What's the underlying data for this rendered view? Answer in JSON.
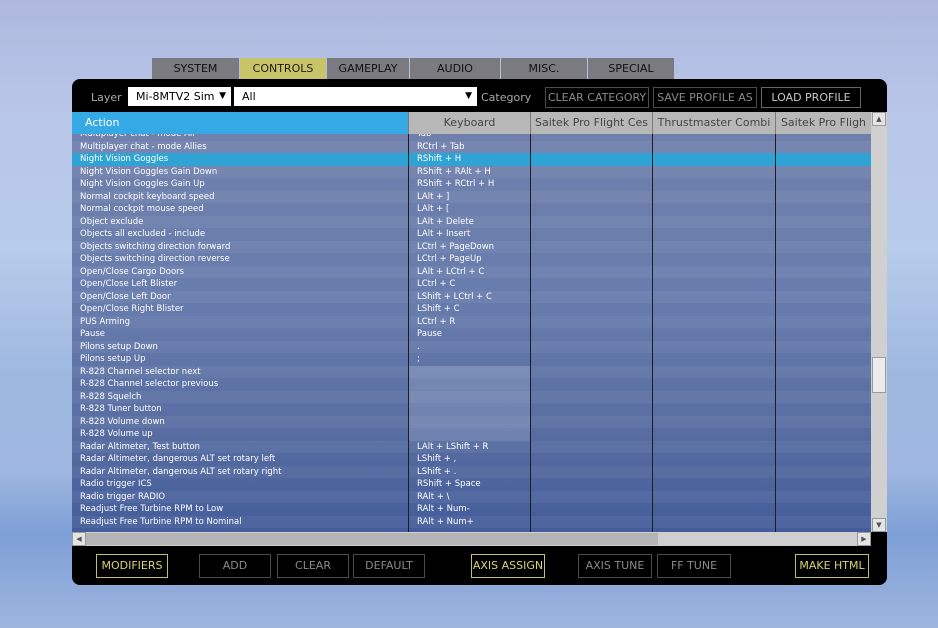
{
  "tabs": [
    {
      "label": "SYSTEM",
      "active": false
    },
    {
      "label": "CONTROLS",
      "active": true
    },
    {
      "label": "GAMEPLAY",
      "active": false
    },
    {
      "label": "AUDIO",
      "active": false
    },
    {
      "label": "MISC.",
      "active": false
    },
    {
      "label": "SPECIAL",
      "active": false
    }
  ],
  "toolbar": {
    "layer_label": "Layer",
    "layer_value": "Mi-8MTV2 Sim",
    "category_value": "All",
    "category_label": "Category",
    "clear_category": "CLEAR CATEGORY",
    "save_profile_as": "SAVE PROFILE AS",
    "load_profile": "LOAD PROFILE"
  },
  "table": {
    "columns": [
      "Action",
      "Keyboard",
      "Saitek Pro Flight Ces",
      "Thrustmaster Combi",
      "Saitek Pro Fligh"
    ],
    "rows": [
      {
        "action": "Multiplayer chat - mode All",
        "keyboard": "Tab"
      },
      {
        "action": "Multiplayer chat - mode Allies",
        "keyboard": "RCtrl + Tab"
      },
      {
        "action": "Night Vision Goggles",
        "keyboard": "RShift + H",
        "selected": true
      },
      {
        "action": "Night Vision Goggles Gain Down",
        "keyboard": "RShift + RAlt + H"
      },
      {
        "action": "Night Vision Goggles Gain Up",
        "keyboard": "RShift + RCtrl + H"
      },
      {
        "action": "Normal cockpit keyboard speed",
        "keyboard": "LAlt + ]"
      },
      {
        "action": "Normal cockpit mouse speed",
        "keyboard": "LAlt + ["
      },
      {
        "action": "Object exclude",
        "keyboard": "LAlt + Delete"
      },
      {
        "action": "Objects all excluded - include",
        "keyboard": "LAlt + Insert"
      },
      {
        "action": "Objects switching direction forward",
        "keyboard": "LCtrl + PageDown"
      },
      {
        "action": "Objects switching direction reverse",
        "keyboard": "LCtrl + PageUp"
      },
      {
        "action": "Open/Close Cargo Doors",
        "keyboard": "LAlt + LCtrl + C"
      },
      {
        "action": "Open/Close Left Blister",
        "keyboard": "LCtrl + C"
      },
      {
        "action": "Open/Close Left Door",
        "keyboard": "LShift + LCtrl + C"
      },
      {
        "action": "Open/Close Right Blister",
        "keyboard": "LShift + C"
      },
      {
        "action": "PUS Arming",
        "keyboard": "LCtrl + R"
      },
      {
        "action": "Pause",
        "keyboard": "Pause"
      },
      {
        "action": "Pilons setup Down",
        "keyboard": "."
      },
      {
        "action": "Pilons setup Up",
        "keyboard": ";"
      },
      {
        "action": "R-828 Channel selector next",
        "keyboard": ""
      },
      {
        "action": "R-828 Channel selector previous",
        "keyboard": ""
      },
      {
        "action": "R-828 Squelch",
        "keyboard": ""
      },
      {
        "action": "R-828 Tuner button",
        "keyboard": ""
      },
      {
        "action": "R-828 Volume down",
        "keyboard": ""
      },
      {
        "action": "R-828 Volume up",
        "keyboard": ""
      },
      {
        "action": "Radar Altimeter, Test button",
        "keyboard": "LAlt + LShift + R"
      },
      {
        "action": "Radar Altimeter, dangerous ALT set rotary left",
        "keyboard": "LShift + ,"
      },
      {
        "action": "Radar Altimeter, dangerous ALT set rotary right",
        "keyboard": "LShift + ."
      },
      {
        "action": "Radio trigger ICS",
        "keyboard": "RShift + Space"
      },
      {
        "action": "Radio trigger RADIO",
        "keyboard": "RAlt + \\"
      },
      {
        "action": "Readjust Free Turbine RPM to Low",
        "keyboard": "RAlt + Num-"
      },
      {
        "action": "Readjust Free Turbine RPM to Nominal",
        "keyboard": "RAlt + Num+"
      }
    ]
  },
  "bottom": {
    "modifiers": "MODIFIERS",
    "add": "ADD",
    "clear": "CLEAR",
    "default": "DEFAULT",
    "axis_assign": "AXIS ASSIGN",
    "axis_tune": "AXIS TUNE",
    "ff_tune": "FF TUNE",
    "make_html": "MAKE HTML"
  },
  "icons": {
    "dropdown": "triangle-down-icon",
    "scroll_up": "arrow-up-icon",
    "scroll_down": "arrow-down-icon",
    "scroll_left": "arrow-left-icon",
    "scroll_right": "arrow-right-icon"
  }
}
